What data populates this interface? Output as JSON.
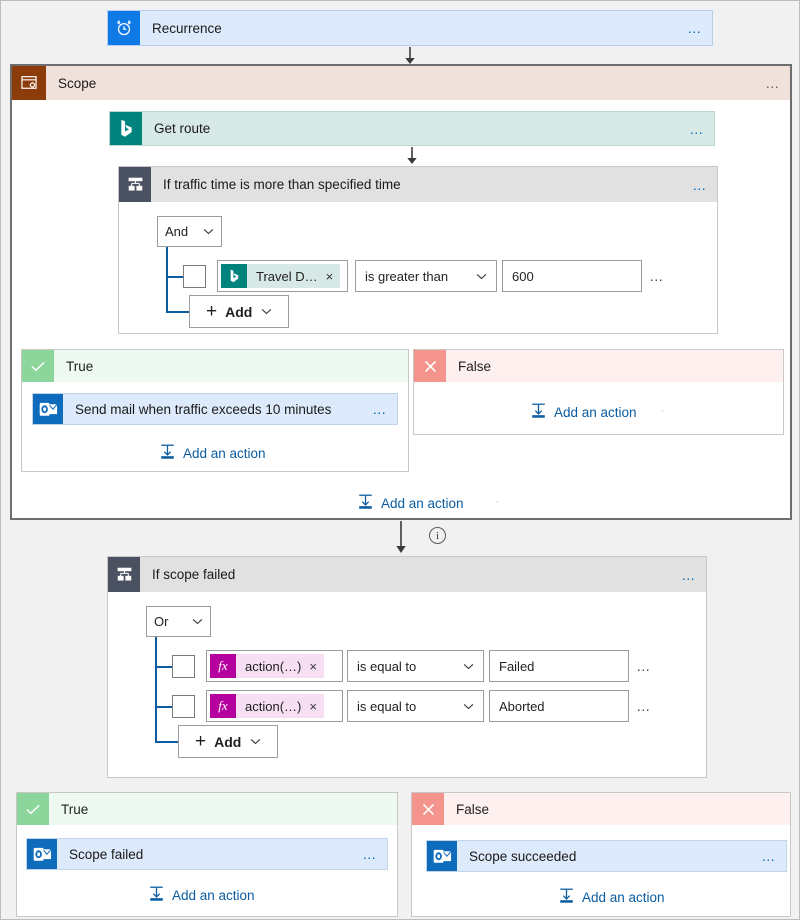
{
  "canvas": {
    "background": "#f1f1f1"
  },
  "colors": {
    "trigger_blue": "#0f7ae6",
    "trigger_bg": "#dceafb",
    "scope_brown": "#8c3b0a",
    "scope_header_bg": "#f0e2da",
    "bing_teal": "#00827d",
    "bing_bg": "#d6e9e6",
    "condition_slate": "#4a5160",
    "condition_header_bg": "#e1e1e1",
    "outlook_blue": "#0f6cbd",
    "true_green": "#8cd69b",
    "true_bg": "#eef9f1",
    "false_red": "#f4948c",
    "false_bg": "#fdf0ef",
    "expression_magenta": "#b4009e",
    "expression_bg": "#f6dff2",
    "link_blue": "#0b5ca0"
  },
  "trigger": {
    "title": "Recurrence",
    "icon": "alarm-clock-icon",
    "menu": "…"
  },
  "scope": {
    "title": "Scope",
    "icon": "scope-icon",
    "menu": "…",
    "footer_add_action": "Add an action",
    "actions": [
      {
        "title": "Get route",
        "icon": "bing-maps-icon",
        "menu": "…"
      }
    ]
  },
  "condition_traffic": {
    "title": "If traffic time is more than specified time",
    "icon": "condition-icon",
    "menu": "…",
    "logic_operator": "And",
    "add_button": "Add",
    "rows": [
      {
        "checkbox_checked": false,
        "token_label": "Travel D…",
        "token_icon": "bing-maps-icon",
        "token_remove": "×",
        "operator": "is greater than",
        "value": "600",
        "menu": "…"
      }
    ],
    "branches": {
      "true": {
        "label": "True",
        "icon": "checkmark-icon",
        "actions": [
          {
            "title": "Send mail when traffic exceeds 10 minutes",
            "icon": "outlook-icon",
            "menu": "…"
          }
        ],
        "add_action": "Add an action"
      },
      "false": {
        "label": "False",
        "icon": "close-icon",
        "actions": [],
        "add_action": "Add an action"
      }
    }
  },
  "condition_scope_failed": {
    "title": "If scope failed",
    "icon": "condition-icon",
    "menu": "…",
    "logic_operator": "Or",
    "add_button": "Add",
    "rows": [
      {
        "checkbox_checked": false,
        "token_label": "action(…)",
        "token_icon": "expression-fx-icon",
        "token_badge": "fx",
        "token_remove": "×",
        "operator": "is equal to",
        "value": "Failed",
        "menu": "…"
      },
      {
        "checkbox_checked": false,
        "token_label": "action(…)",
        "token_icon": "expression-fx-icon",
        "token_badge": "fx",
        "token_remove": "×",
        "operator": "is equal to",
        "value": "Aborted",
        "menu": "…"
      }
    ],
    "branches": {
      "true": {
        "label": "True",
        "icon": "checkmark-icon",
        "actions": [
          {
            "title": "Scope failed",
            "icon": "outlook-icon",
            "menu": "…"
          }
        ],
        "add_action": "Add an action"
      },
      "false": {
        "label": "False",
        "icon": "close-icon",
        "actions": [
          {
            "title": "Scope succeeded",
            "icon": "outlook-icon",
            "menu": "…"
          }
        ],
        "add_action": "Add an action"
      }
    }
  },
  "info_marker": {
    "glyph": "i",
    "name": "info-icon"
  }
}
